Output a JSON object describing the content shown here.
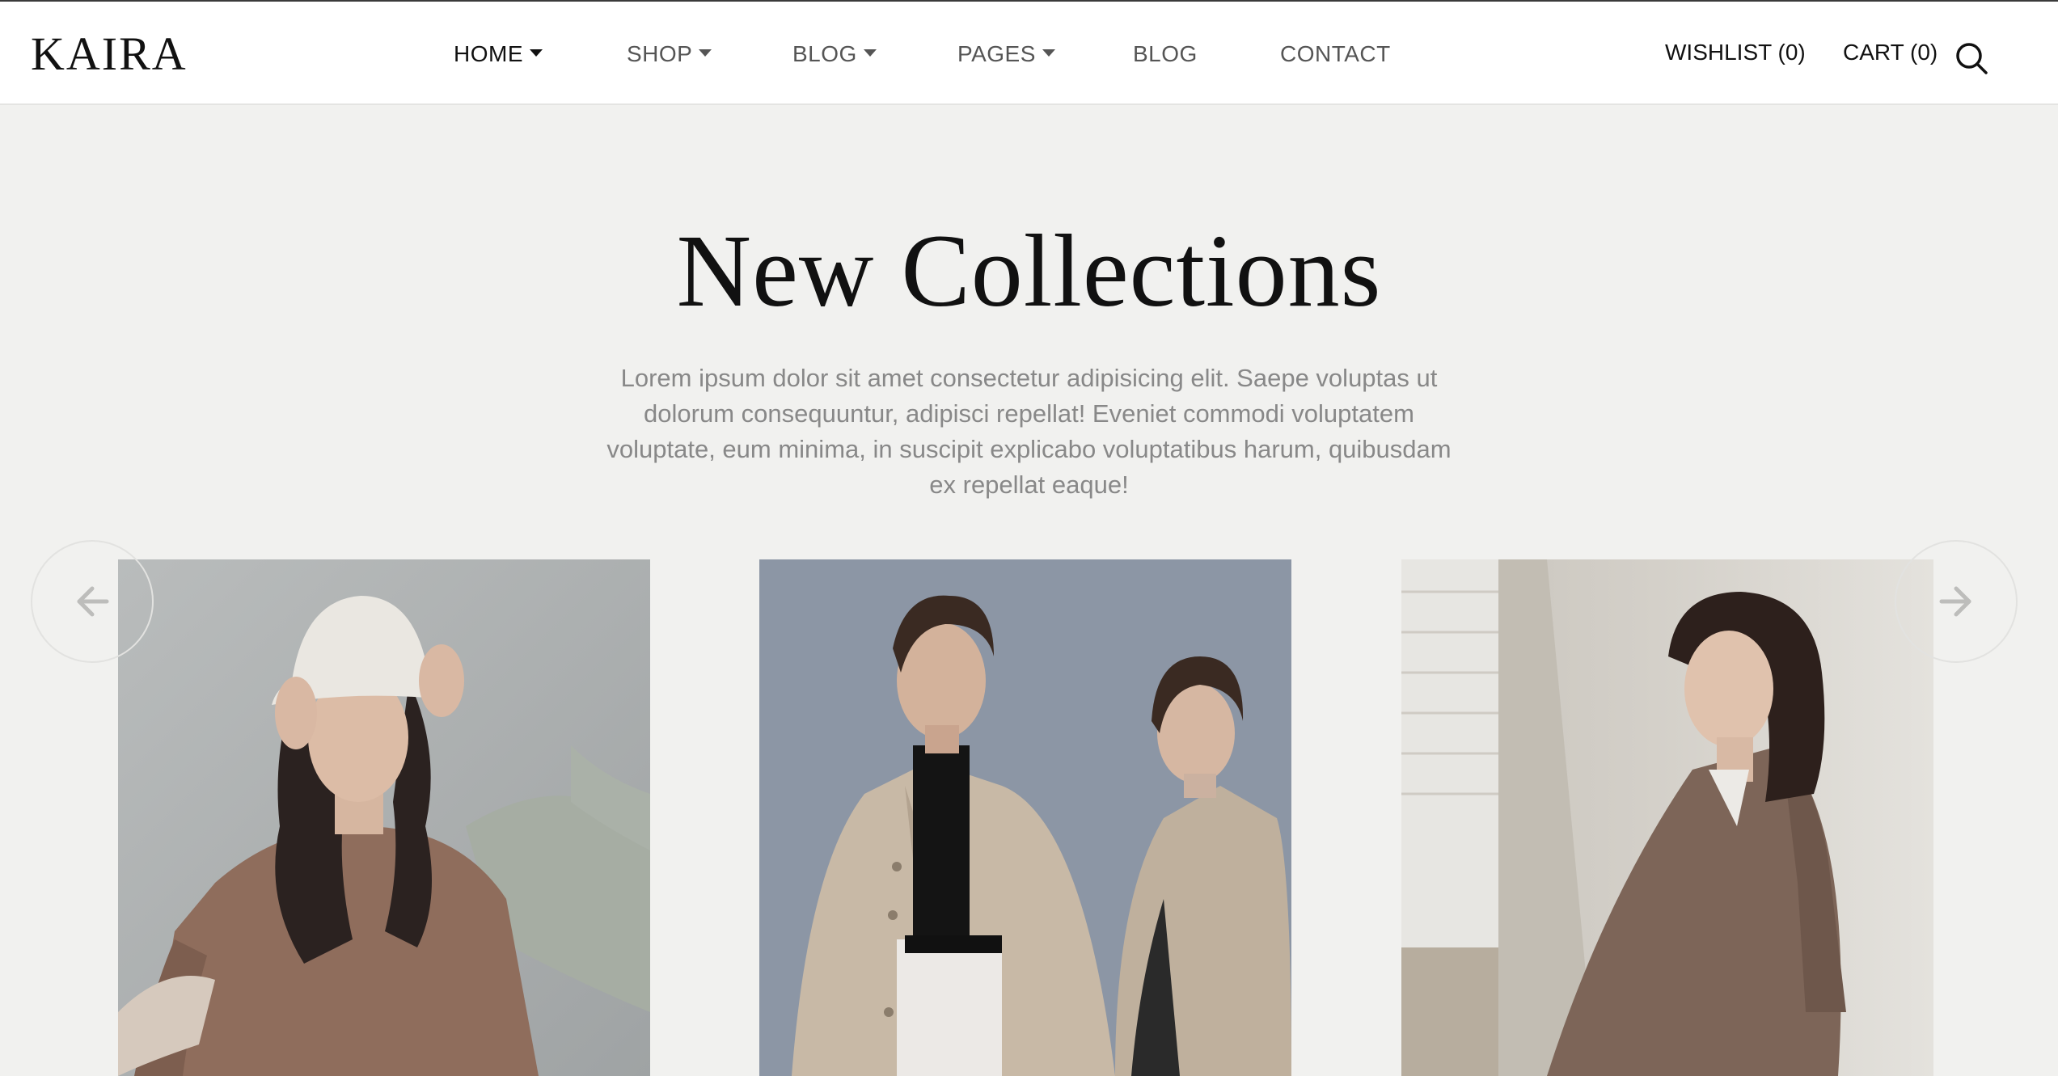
{
  "brand": {
    "logo_text": "KAIRA"
  },
  "nav": {
    "items": [
      {
        "label": "HOME",
        "has_dropdown": true,
        "active": true
      },
      {
        "label": "SHOP",
        "has_dropdown": true,
        "active": false
      },
      {
        "label": "BLOG",
        "has_dropdown": true,
        "active": false
      },
      {
        "label": "PAGES",
        "has_dropdown": true,
        "active": false
      },
      {
        "label": "BLOG",
        "has_dropdown": false,
        "active": false
      },
      {
        "label": "CONTACT",
        "has_dropdown": false,
        "active": false
      }
    ]
  },
  "header_actions": {
    "wishlist_label": "WISHLIST (0)",
    "cart_label": "CART (0)",
    "search_icon": "search-icon"
  },
  "hero": {
    "title": "New Collections",
    "description": "Lorem ipsum dolor sit amet consectetur adipisicing elit. Saepe voluptas ut dolorum consequuntur, adipisci repellat! Eveniet commodi voluptatem voluptate, eum minima, in suscipit explicabo voluptatibus harum, quibusdam ex repellat eaque!"
  },
  "carousel": {
    "prev_icon": "arrow-left-icon",
    "next_icon": "arrow-right-icon",
    "products": [
      {
        "image": "woman-bucket-hat-photo"
      },
      {
        "image": "two-women-trench-coats-photo"
      },
      {
        "image": "woman-plaid-blazer-photo"
      }
    ]
  },
  "colors": {
    "page_background": "#f1f1ef",
    "header_background": "#ffffff",
    "text_primary": "#111111",
    "text_muted": "#888888",
    "nav_inactive": "#555555"
  }
}
